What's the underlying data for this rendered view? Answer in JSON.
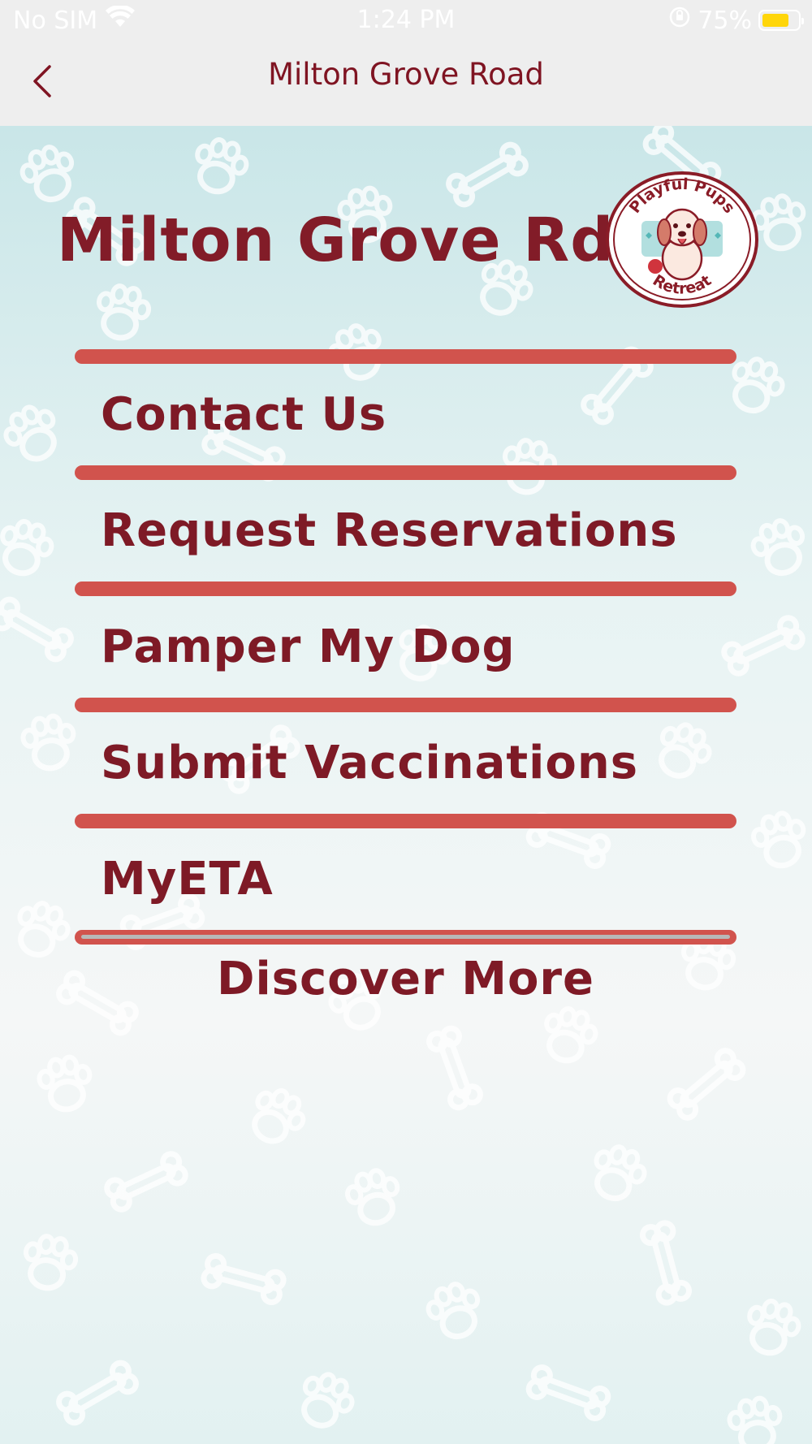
{
  "status_bar": {
    "carrier": "No SIM",
    "time": "1:24 PM",
    "battery_percent": "75%",
    "battery_level": 0.75,
    "icons": [
      "wifi-icon",
      "orientation-lock-icon",
      "battery-icon"
    ]
  },
  "nav": {
    "back_icon": "chevron-left-icon",
    "title": "Milton Grove Road"
  },
  "header": {
    "title": "Milton Grove Rd",
    "logo": {
      "top_text": "Playful Pups",
      "bottom_text": "Retreat"
    }
  },
  "menu": {
    "items": [
      {
        "label": "Contact Us"
      },
      {
        "label": "Request Reservations"
      },
      {
        "label": "Pamper My Dog"
      },
      {
        "label": "Submit Vaccinations"
      },
      {
        "label": "MyETA"
      }
    ],
    "discover_more": "Discover More"
  },
  "colors": {
    "brand": "#7e1a26",
    "divider": "#d1534d",
    "nav_title": "#7f1422",
    "background_top": "#c9e6e8",
    "battery": "#ffd60a"
  }
}
